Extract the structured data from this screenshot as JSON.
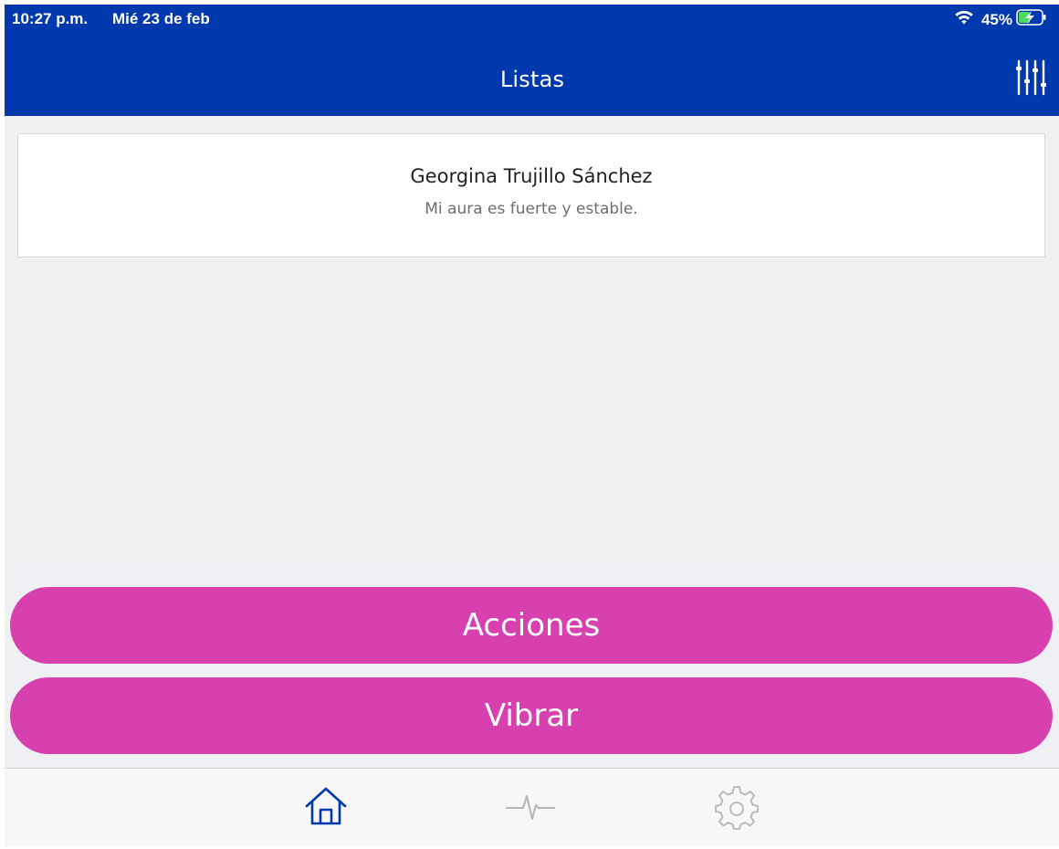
{
  "status_bar": {
    "time": "10:27 p.m.",
    "date": "Mié 23 de feb",
    "battery_percent": "45%",
    "icons": [
      "wifi-icon",
      "battery-charging-icon"
    ]
  },
  "nav": {
    "title": "Listas",
    "filter_icon": "sliders-icon"
  },
  "list": {
    "items": [
      {
        "name": "Georgina Trujillo Sánchez",
        "subtitle": "Mi aura es fuerte y estable."
      }
    ]
  },
  "buttons": {
    "actions_label": "Acciones",
    "vibrate_label": "Vibrar"
  },
  "tabbar": {
    "tabs": [
      {
        "icon": "home-icon",
        "selected": true
      },
      {
        "icon": "pulse-icon",
        "selected": false
      },
      {
        "icon": "gear-icon",
        "selected": false
      }
    ]
  },
  "colors": {
    "header": "#0038ad",
    "button": "#d740ae",
    "background": "#f0f0f0",
    "tab_active": "#0038ad",
    "tab_inactive": "#b5b5b5"
  }
}
